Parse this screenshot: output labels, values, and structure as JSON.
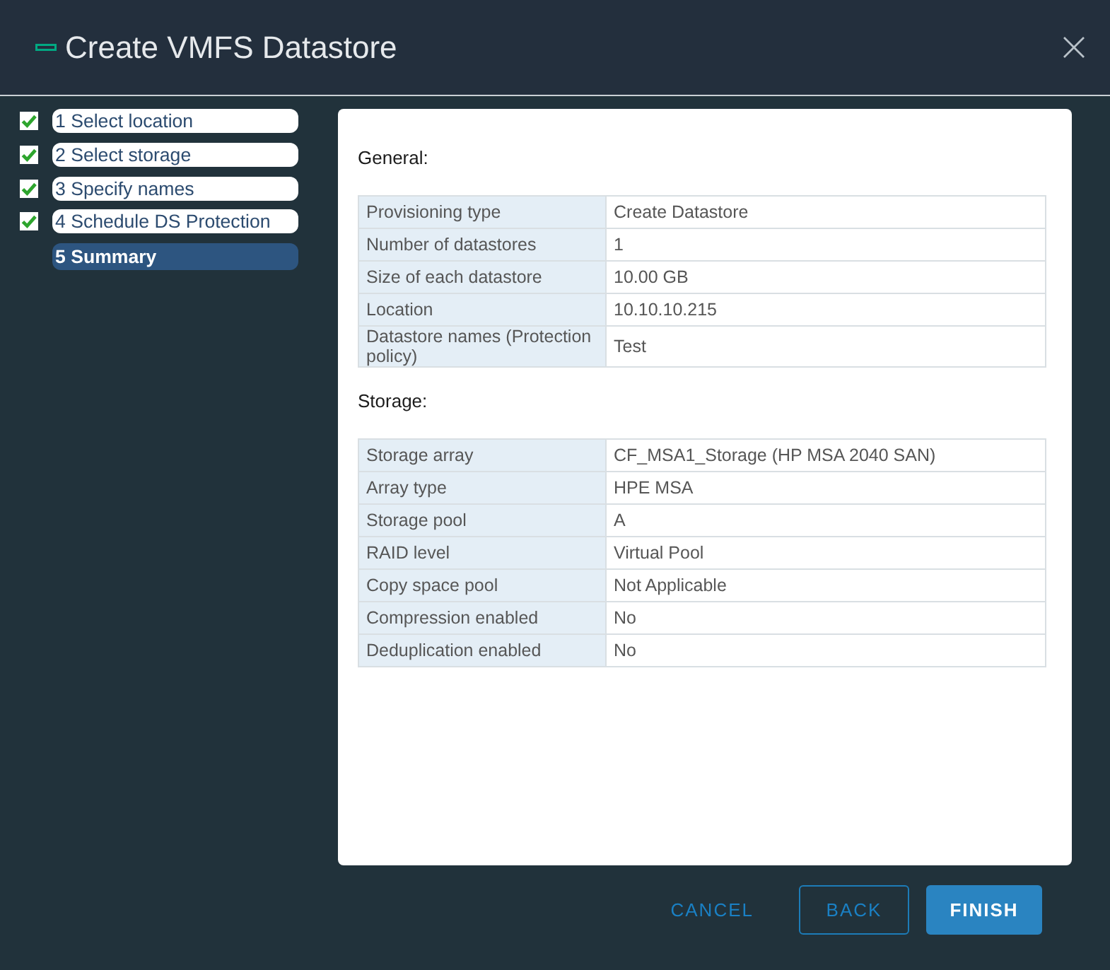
{
  "window": {
    "title": "Create VMFS Datastore"
  },
  "steps": [
    {
      "label": "1 Select location",
      "completed": true,
      "selected": false
    },
    {
      "label": "2 Select storage",
      "completed": true,
      "selected": false
    },
    {
      "label": "3 Specify names",
      "completed": true,
      "selected": false
    },
    {
      "label": "4 Schedule DS Protection",
      "completed": true,
      "selected": false
    },
    {
      "label": "5 Summary",
      "completed": false,
      "selected": true
    }
  ],
  "sections": [
    {
      "heading": "General:",
      "rows": [
        {
          "label": "Provisioning type",
          "value": "Create Datastore"
        },
        {
          "label": "Number of datastores",
          "value": "1"
        },
        {
          "label": "Size of each datastore",
          "value": "10.00 GB"
        },
        {
          "label": "Location",
          "value": "10.10.10.215"
        },
        {
          "label": "Datastore names (Protection policy)",
          "value": "Test"
        }
      ]
    },
    {
      "heading": "Storage:",
      "rows": [
        {
          "label": "Storage array",
          "value": "CF_MSA1_Storage (HP MSA 2040 SAN)"
        },
        {
          "label": "Array type",
          "value": "HPE MSA"
        },
        {
          "label": "Storage pool",
          "value": "A"
        },
        {
          "label": "RAID level",
          "value": "Virtual Pool"
        },
        {
          "label": "Copy space pool",
          "value": "Not Applicable"
        },
        {
          "label": "Compression enabled",
          "value": "No"
        },
        {
          "label": "Deduplication enabled",
          "value": "No"
        }
      ]
    }
  ],
  "buttons": [
    {
      "label": "CANCEL",
      "kind": "link"
    },
    {
      "label": "BACK",
      "kind": "outline"
    },
    {
      "label": "FINISH",
      "kind": "primary"
    }
  ]
}
